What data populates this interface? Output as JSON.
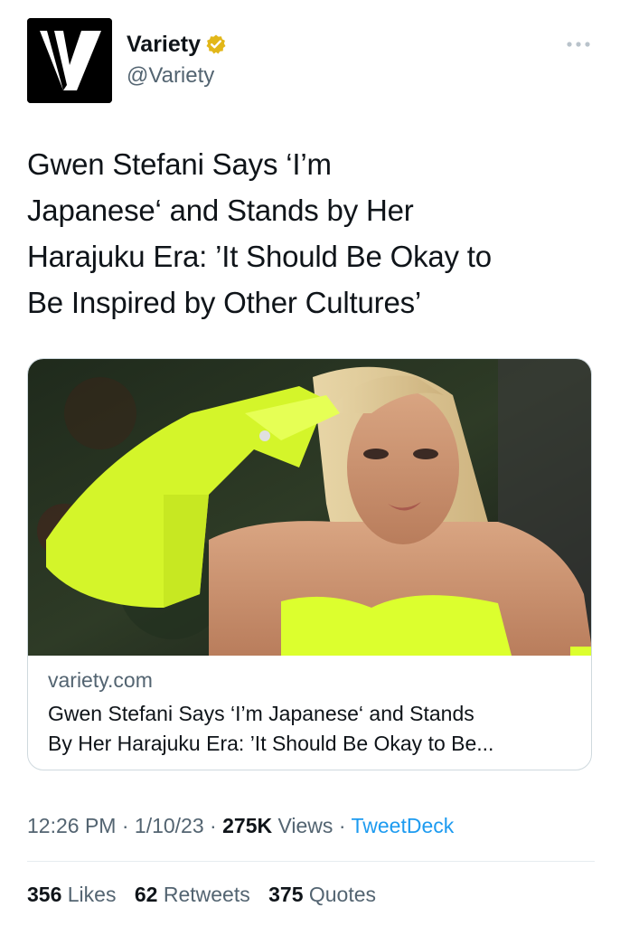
{
  "account": {
    "display_name": "Variety",
    "handle": "@Variety",
    "logo_letter": "V",
    "verified_badge_color": "#e2b719"
  },
  "tweet": {
    "text_lines": [
      "Gwen Stefani Says ‘I’m",
      "Japanese‘ and Stands by Her",
      "Harajuku Era: ’It Should Be Okay to",
      "Be Inspired by Other Cultures’"
    ]
  },
  "card": {
    "image_alt_icon": "photo-woman-neon-yellow-gloves",
    "domain": "variety.com",
    "title_lines": [
      "Gwen Stefani Says ‘I’m Japanese‘ and Stands",
      "By Her Harajuku Era: ’It Should Be Okay to Be..."
    ]
  },
  "meta": {
    "time": "12:26 PM",
    "date": "1/10/23",
    "views_count": "275K",
    "views_label": "Views",
    "source": "TweetDeck",
    "separator": "·"
  },
  "stats": {
    "likes_count": "356",
    "likes_label": "Likes",
    "retweets_count": "62",
    "retweets_label": "Retweets",
    "quotes_count": "375",
    "quotes_label": "Quotes"
  },
  "colors": {
    "text_primary": "#0f1419",
    "text_secondary": "#536471",
    "link": "#1d9bf0",
    "neon": "#dcff2e"
  }
}
